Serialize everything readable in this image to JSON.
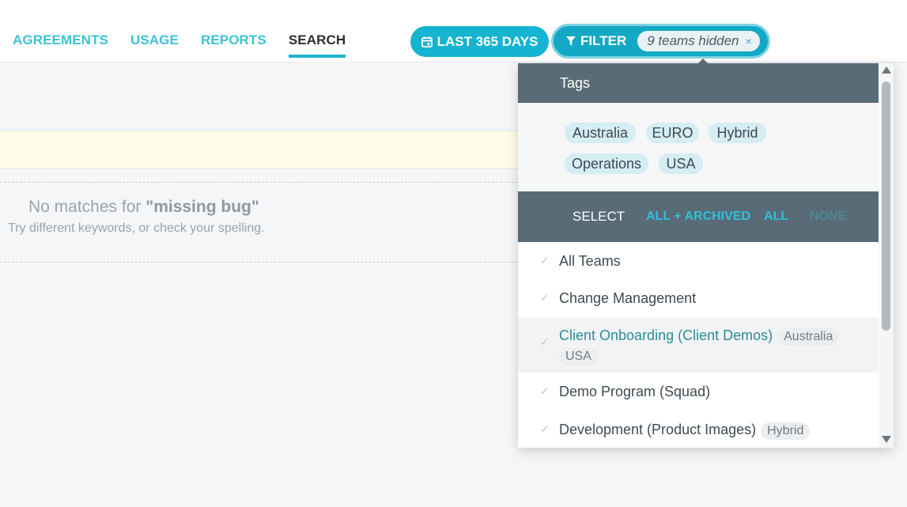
{
  "nav": {
    "agreements": "AGREEMENTS",
    "usage": "USAGE",
    "reports": "REPORTS",
    "search": "SEARCH"
  },
  "date_button": {
    "label": "LAST 365 DAYS",
    "icon": "calendar-icon"
  },
  "filter_button": {
    "label": "FILTER",
    "icon": "filter-icon",
    "hidden_chip": "9 teams hidden",
    "clear_icon": "×"
  },
  "results": {
    "no_match_prefix": "No matches for ",
    "query": "\"missing bug\"",
    "hint": "Try different keywords, or check your spelling."
  },
  "panel": {
    "tags_title": "Tags",
    "tags": [
      "Australia",
      "EURO",
      "Hybrid",
      "Operations",
      "USA"
    ],
    "select_label": "SELECT",
    "select_all_archived": "ALL + ARCHIVED",
    "select_all": "ALL",
    "select_none": "NONE",
    "check_glyph": "✓",
    "teams": [
      {
        "name": "All Teams",
        "tags": []
      },
      {
        "name": "Change Management",
        "tags": []
      },
      {
        "name": "Client Onboarding (Client Demos)",
        "tags": [
          "Australia",
          "USA"
        ]
      },
      {
        "name": "Demo Program (Squad)",
        "tags": []
      },
      {
        "name": "Development (Product Images)",
        "tags": [
          "Hybrid"
        ]
      }
    ]
  },
  "colors": {
    "accent": "#15b4d0",
    "panel_header": "#586b76",
    "highlight_text": "#2b8c98"
  }
}
